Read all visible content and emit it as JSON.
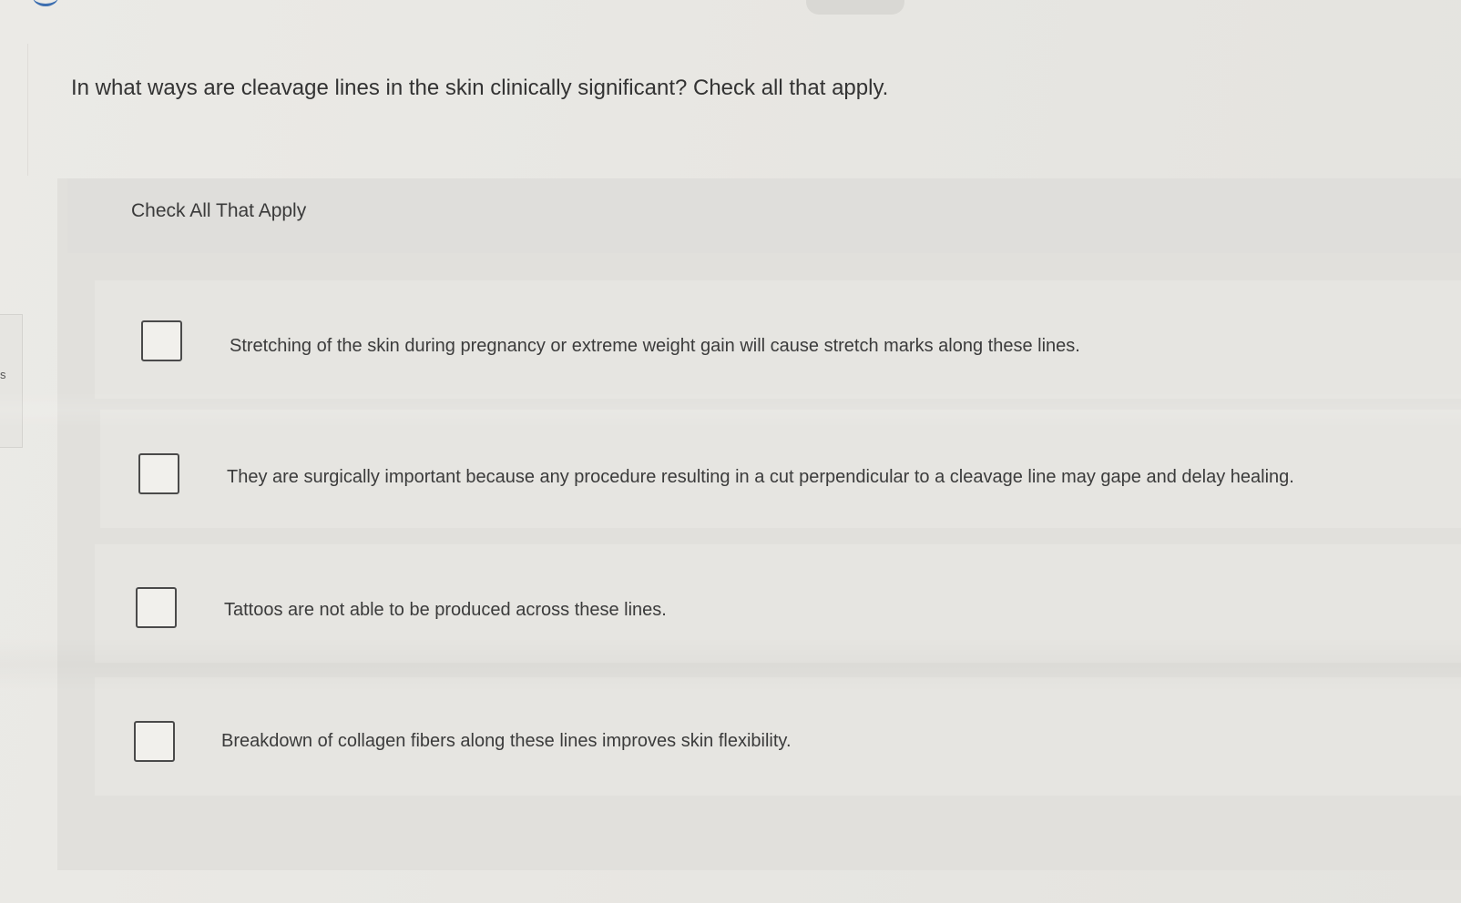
{
  "question": {
    "text": "In what ways are cleavage lines in the skin clinically significant? Check all that apply."
  },
  "panel": {
    "title": "Check All That Apply"
  },
  "options": [
    {
      "label": "Stretching of the skin during pregnancy or extreme weight gain will cause stretch marks along these lines.",
      "checked": false
    },
    {
      "label": "They are surgically important because any procedure resulting in a cut perpendicular to a cleavage line may gape and delay healing.",
      "checked": false
    },
    {
      "label": "Tattoos are not able to be produced across these lines.",
      "checked": false
    },
    {
      "label": "Breakdown of collagen fibers along these lines improves skin flexibility.",
      "checked": false
    }
  ],
  "side_tab": {
    "text": "s"
  },
  "colors": {
    "background": "#e9e8e4",
    "panel": "#e1e0dc",
    "text": "#333333",
    "checkbox_border": "#4a4a4a"
  }
}
